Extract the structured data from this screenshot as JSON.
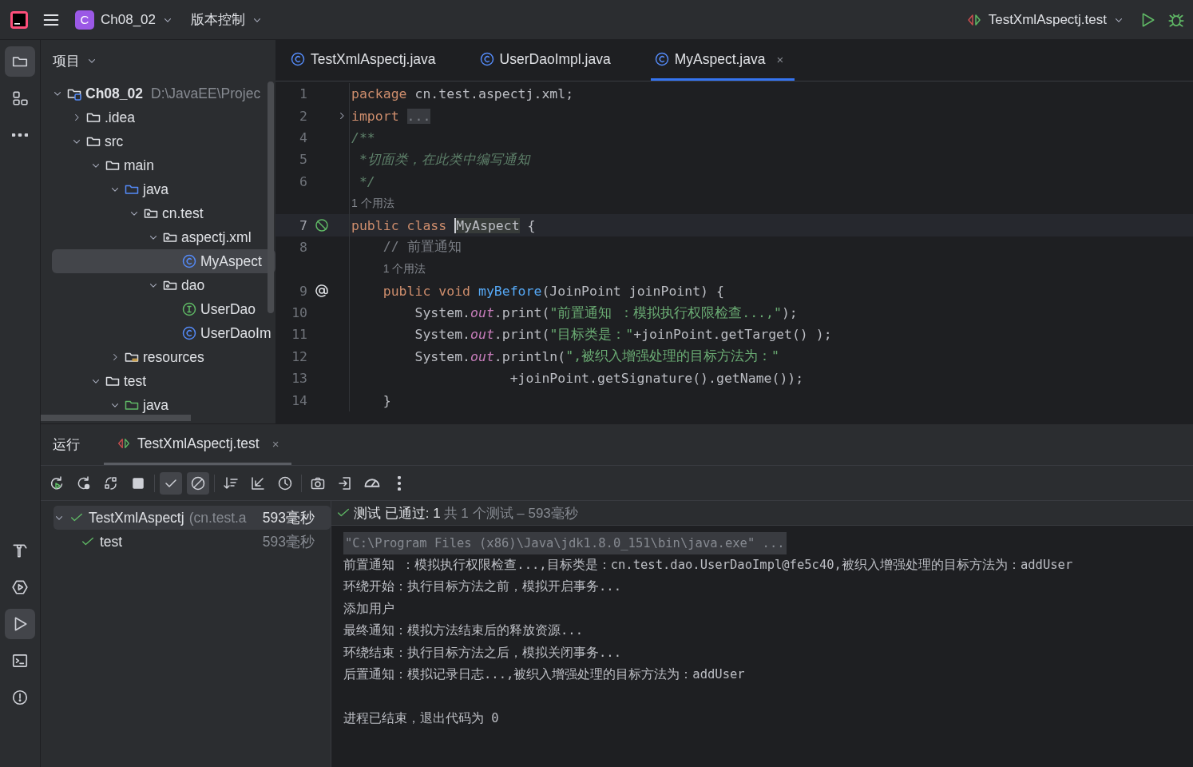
{
  "title_bar": {
    "project": {
      "badge": "C",
      "name": "Ch08_02"
    },
    "vcs": "版本控制",
    "run_config": "TestXmlAspectj.test"
  },
  "left_toolbar": {
    "top": [
      {
        "kind": "folder",
        "selected": true
      },
      {
        "kind": "structure",
        "selected": false
      },
      {
        "kind": "more",
        "selected": false
      }
    ],
    "bottom": [
      {
        "kind": "hammer",
        "selected": false
      },
      {
        "kind": "services",
        "selected": false
      },
      {
        "kind": "run",
        "selected": true
      },
      {
        "kind": "terminal",
        "selected": false
      },
      {
        "kind": "problems",
        "selected": false
      }
    ]
  },
  "project_panel": {
    "title": "项目",
    "tree": [
      {
        "label": "Ch08_02",
        "detail": "D:\\JavaEE\\Projec",
        "kind": "module",
        "expanded": true,
        "selected": false,
        "children": [
          {
            "label": ".idea",
            "kind": "folder",
            "expanded": false,
            "selected": false
          },
          {
            "label": "src",
            "kind": "folder",
            "expanded": true,
            "selected": false,
            "children": [
              {
                "label": "main",
                "kind": "folder",
                "expanded": true,
                "selected": false,
                "children": [
                  {
                    "label": "java",
                    "kind": "source",
                    "expanded": true,
                    "selected": false,
                    "children": [
                      {
                        "label": "cn.test",
                        "kind": "package",
                        "expanded": true,
                        "selected": false,
                        "children": [
                          {
                            "label": "aspectj.xml",
                            "kind": "package",
                            "expanded": true,
                            "selected": false,
                            "children": [
                              {
                                "label": "MyAspect",
                                "kind": "class",
                                "selected": true
                              }
                            ]
                          },
                          {
                            "label": "dao",
                            "kind": "package",
                            "expanded": true,
                            "selected": false,
                            "children": [
                              {
                                "label": "UserDao",
                                "kind": "interface",
                                "selected": false
                              },
                              {
                                "label": "UserDaoIm",
                                "kind": "class",
                                "selected": false
                              }
                            ]
                          }
                        ]
                      }
                    ]
                  },
                  {
                    "label": "resources",
                    "kind": "resources",
                    "expanded": false,
                    "selected": false
                  }
                ]
              },
              {
                "label": "test",
                "kind": "folder",
                "expanded": true,
                "selected": false,
                "children": [
                  {
                    "label": "java",
                    "kind": "test",
                    "expanded": true,
                    "selected": false
                  }
                ]
              }
            ]
          }
        ]
      }
    ]
  },
  "editor": {
    "tabs": [
      {
        "label": "TestXmlAspectj.java",
        "selected": false
      },
      {
        "label": "UserDaoImpl.java",
        "selected": false
      },
      {
        "label": "MyAspect.java",
        "selected": true,
        "close": "×"
      }
    ],
    "lines": [
      {
        "num": "1",
        "current": false,
        "tokens": [
          {
            "t": "package",
            "kind": "kw"
          },
          {
            "t": " cn.test.aspectj.xml;",
            "kind": "plain"
          }
        ]
      },
      {
        "num": "2",
        "current": false,
        "fold": true,
        "tokens": [
          {
            "t": "import ",
            "kind": "kw"
          },
          {
            "t": "...",
            "kind": "folded"
          }
        ]
      },
      {
        "num": "4",
        "current": false,
        "tokens": [
          {
            "t": "/**",
            "kind": "doc"
          }
        ]
      },
      {
        "num": "5",
        "current": false,
        "tokens": [
          {
            "t": " *切面类，在此类中编写通知",
            "kind": "doc"
          }
        ]
      },
      {
        "num": "6",
        "current": false,
        "tokens": [
          {
            "t": " */",
            "kind": "doc"
          }
        ]
      },
      {
        "current": false,
        "tokens": [
          {
            "t": "1 个用法",
            "kind": "hint"
          }
        ]
      },
      {
        "num": "7",
        "current": true,
        "gutter": {
          "kind": "aspect"
        },
        "tokens": [
          {
            "t": "public class ",
            "kind": "kw"
          },
          {
            "t": "MyAspect",
            "kind": "hl"
          },
          {
            "t": " {",
            "kind": "plain"
          }
        ]
      },
      {
        "num": "8",
        "current": false,
        "tokens": [
          {
            "t": "    // 前置通知",
            "kind": "comment"
          }
        ]
      },
      {
        "current": false,
        "tokens": [
          {
            "t": "1 个用法",
            "kind": "hint"
          }
        ]
      },
      {
        "num": "9",
        "current": false,
        "gutter": {
          "kind": "advice"
        },
        "tokens": [
          {
            "t": "    public void ",
            "kind": "kw"
          },
          {
            "t": "myBefore",
            "kind": "decl"
          },
          {
            "t": "(JoinPoint joinPoint) {",
            "kind": "plain"
          }
        ]
      },
      {
        "num": "10",
        "current": false,
        "tokens": [
          {
            "t": "        System.",
            "kind": "plain"
          },
          {
            "t": "out",
            "kind": "field"
          },
          {
            "t": ".print(",
            "kind": "plain"
          },
          {
            "t": "\"前置通知 ：模拟执行权限检查...,\"",
            "kind": "string"
          },
          {
            "t": ");",
            "kind": "plain"
          }
        ]
      },
      {
        "num": "11",
        "current": false,
        "tokens": [
          {
            "t": "        System.",
            "kind": "plain"
          },
          {
            "t": "out",
            "kind": "field"
          },
          {
            "t": ".print(",
            "kind": "plain"
          },
          {
            "t": "\"目标类是：\"",
            "kind": "string"
          },
          {
            "t": "+joinPoint.getTarget() );",
            "kind": "plain"
          }
        ]
      },
      {
        "num": "12",
        "current": false,
        "tokens": [
          {
            "t": "        System.",
            "kind": "plain"
          },
          {
            "t": "out",
            "kind": "field"
          },
          {
            "t": ".println(",
            "kind": "plain"
          },
          {
            "t": "\",被织入增强处理的目标方法为：\"",
            "kind": "string"
          }
        ]
      },
      {
        "num": "13",
        "current": false,
        "tokens": [
          {
            "t": "                    +joinPoint.getSignature().getName());",
            "kind": "plain"
          }
        ]
      },
      {
        "num": "14",
        "current": false,
        "tokens": [
          {
            "t": "    }",
            "kind": "plain"
          }
        ]
      }
    ]
  },
  "run_panel": {
    "title": "运行",
    "tab": {
      "label": "TestXmlAspectj.test",
      "selected": true,
      "close": "×"
    },
    "toolbar": [
      {
        "kind": "rerun",
        "selected": false
      },
      {
        "kind": "rerun-failed",
        "selected": false
      },
      {
        "kind": "toggle-auto",
        "selected": false
      },
      {
        "kind": "stop",
        "selected": false
      },
      {
        "kind": "passed",
        "selected": true
      },
      {
        "kind": "ignored",
        "selected": true
      },
      {
        "kind": "sort",
        "selected": false
      },
      {
        "kind": "collapse",
        "selected": false
      },
      {
        "kind": "history",
        "selected": false
      },
      {
        "kind": "camera",
        "selected": false
      },
      {
        "kind": "import",
        "selected": false
      },
      {
        "kind": "gauge",
        "selected": false
      },
      {
        "kind": "more",
        "selected": false
      }
    ],
    "tests": [
      {
        "name": "TestXmlAspectj",
        "detail": "(cn.test.a",
        "time": "593毫秒",
        "expanded": true,
        "selected": true,
        "children": [
          {
            "name": "test",
            "time": "593毫秒",
            "selected": false
          }
        ]
      }
    ],
    "summary": {
      "status": "测试 已通过: 1",
      "detail": "共 1 个测试 – 593毫秒"
    },
    "console": [
      {
        "kind": "command",
        "text": "\"C:\\Program Files (x86)\\Java\\jdk1.8.0_151\\bin\\java.exe\" ..."
      },
      {
        "kind": "out",
        "text": "前置通知 ：模拟执行权限检查...,目标类是：cn.test.dao.UserDaoImpl@fe5c40,被织入增强处理的目标方法为：addUser"
      },
      {
        "kind": "out",
        "text": "环绕开始：执行目标方法之前，模拟开启事务..."
      },
      {
        "kind": "out",
        "text": "添加用户"
      },
      {
        "kind": "out",
        "text": "最终通知：模拟方法结束后的释放资源..."
      },
      {
        "kind": "out",
        "text": "环绕结束：执行目标方法之后，模拟关闭事务..."
      },
      {
        "kind": "out",
        "text": "后置通知：模拟记录日志...,被织入增强处理的目标方法为：addUser"
      },
      {
        "kind": "blank"
      },
      {
        "kind": "out",
        "text": "进程已结束，退出代码为 0"
      }
    ]
  }
}
